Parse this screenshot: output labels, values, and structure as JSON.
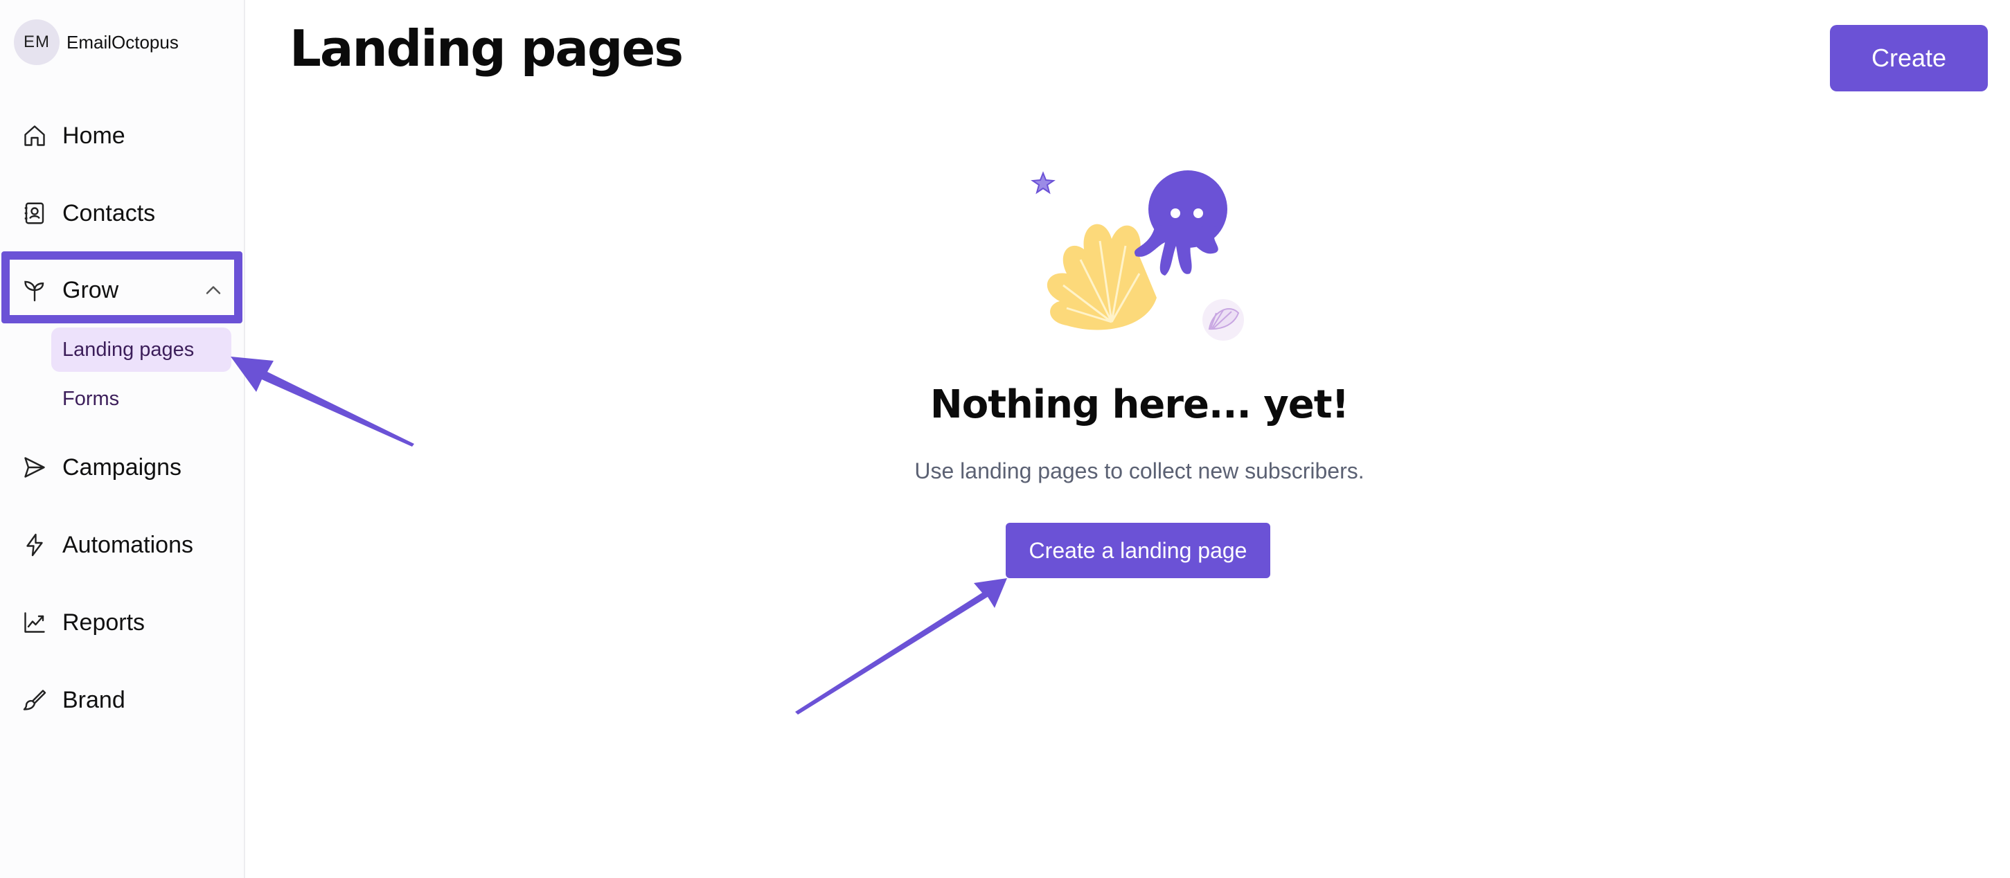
{
  "account": {
    "initials": "EM",
    "name": "EmailOctopus"
  },
  "sidebar": {
    "items": [
      {
        "label": "Home",
        "icon": "home-icon"
      },
      {
        "label": "Contacts",
        "icon": "contacts-icon"
      },
      {
        "label": "Grow",
        "icon": "sprout-icon",
        "expanded": true,
        "children": [
          {
            "label": "Landing pages",
            "active": true
          },
          {
            "label": "Forms"
          }
        ]
      },
      {
        "label": "Campaigns",
        "icon": "send-icon"
      },
      {
        "label": "Automations",
        "icon": "lightning-icon"
      },
      {
        "label": "Reports",
        "icon": "chart-icon"
      },
      {
        "label": "Brand",
        "icon": "brush-icon"
      }
    ]
  },
  "header": {
    "title": "Landing pages",
    "create_label": "Create"
  },
  "empty_state": {
    "title": "Nothing here... yet!",
    "subtitle": "Use landing pages to collect new subscribers.",
    "cta_label": "Create a landing page"
  },
  "colors": {
    "accent": "#6b52d6",
    "active_bg": "#ede2fb",
    "illustration_yellow": "#fcd97a"
  }
}
